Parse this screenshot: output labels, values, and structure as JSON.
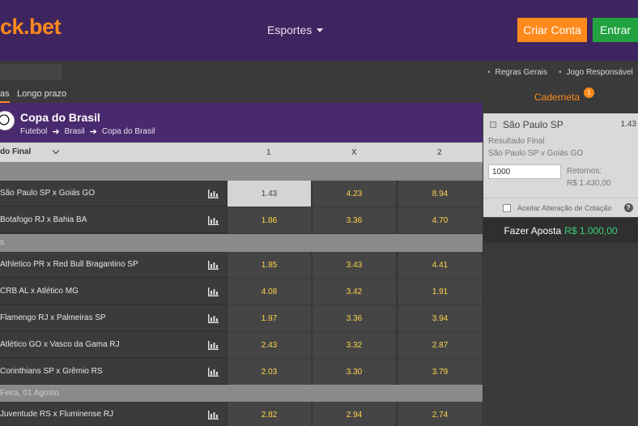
{
  "header": {
    "logo": "ck.bet",
    "nav_sport": "Esportes",
    "signup_label": "Criar Conta",
    "login_label": "Entrar"
  },
  "tabs": {
    "active": "as",
    "long_term": "Longo prazo"
  },
  "competition": {
    "title": "Copa do Brasil",
    "breadcrumb": [
      "Futebol",
      "Brasil",
      "Copa do Brasil"
    ]
  },
  "columns": {
    "market": "do Final",
    "one": "1",
    "draw": "X",
    "two": "2"
  },
  "groups": [
    {
      "label": ""
    },
    {
      "label": "s"
    },
    {
      "label": "Feira, 01 Agosto"
    }
  ],
  "matches": [
    {
      "teams": "São Paulo SP x Goiás GO",
      "odds": [
        "1.43",
        "4.23",
        "8.94"
      ]
    },
    {
      "teams": "Botafogo RJ x Bahia BA",
      "odds": [
        "1.86",
        "3.36",
        "4.70"
      ]
    },
    {
      "teams": "Athletico PR x Red Bull Bragantino SP",
      "odds": [
        "1.85",
        "3.43",
        "4.41"
      ]
    },
    {
      "teams": "CRB AL x Atlético MG",
      "odds": [
        "4.08",
        "3.42",
        "1.91"
      ]
    },
    {
      "teams": "Flamengo RJ x Palmeiras SP",
      "odds": [
        "1.97",
        "3.36",
        "3.94"
      ]
    },
    {
      "teams": "Atlético GO x Vasco da Gama RJ",
      "odds": [
        "2.43",
        "3.32",
        "2.87"
      ]
    },
    {
      "teams": "Corinthians SP x Grêmio RS",
      "odds": [
        "2.03",
        "3.30",
        "3.79"
      ]
    },
    {
      "teams": "Juventude RS x Fluminense RJ",
      "odds": [
        "2.82",
        "2.94",
        "2.74"
      ]
    }
  ],
  "right_links": [
    "Regras Gerais",
    "Jogo Responsável"
  ],
  "betslip": {
    "title": "Caderneta",
    "count": "1",
    "selection": "São Paulo SP",
    "odd": "1.43",
    "market": "Resultado Final",
    "match": "São Paulo SP v Goiás GO",
    "stake": "1000",
    "returns_label": "Retornos:",
    "returns_value": "R$ 1.430,00",
    "accept_change": "Aceitar Alteração de Cotação",
    "help": "?",
    "place_label": "Fazer Aposta",
    "place_amount": "R$ 1.000,00"
  },
  "colors": {
    "brand_orange": "#ff8a1c",
    "header_purple": "#3f2560",
    "login_green": "#21a13f",
    "odds_yellow": "#ffd44a"
  }
}
